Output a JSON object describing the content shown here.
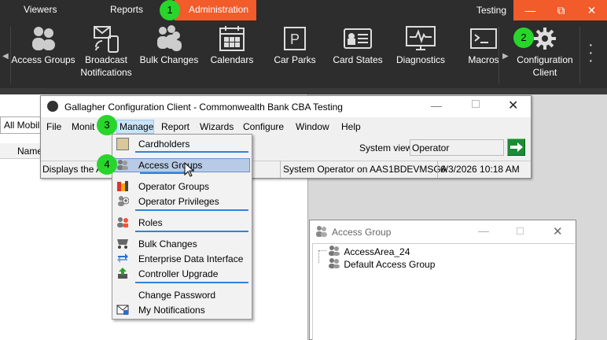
{
  "top_tabs": [
    "Viewers",
    "Reports",
    "Administration"
  ],
  "title_right": "Testing",
  "window_controls": {
    "minimize": "—",
    "maximize": "⧉",
    "close": "✕"
  },
  "ribbon": {
    "items": [
      {
        "label": "Access Groups",
        "icon": "people-icon"
      },
      {
        "label": "Broadcast Notifications",
        "icon": "broadcast-icon"
      },
      {
        "label": "Bulk Changes",
        "icon": "bulk-people-icon"
      },
      {
        "label": "Calendars",
        "icon": "calendar-icon"
      },
      {
        "label": "Car Parks",
        "icon": "parking-icon"
      },
      {
        "label": "Card States",
        "icon": "card-icon"
      },
      {
        "label": "Diagnostics",
        "icon": "monitor-pulse-icon"
      },
      {
        "label": "Macros",
        "icon": "terminal-icon"
      }
    ],
    "config_client": "Configuration Client"
  },
  "left_pane": {
    "filter": "All Mobil",
    "column": "Name"
  },
  "client": {
    "title": "Gallagher Configuration Client - Commonwealth Bank CBA Testing",
    "menu": [
      "File",
      "Monit",
      "Manage",
      "Report",
      "Wizards",
      "Configure",
      "Window",
      "Help"
    ],
    "system_view_label": "System view:",
    "system_view_value": "Operator",
    "status_left": "Displays the A",
    "status_operator": "System Operator on AAS1BDEVMSGA",
    "status_datetime": "6/3/2026 10:18 AM"
  },
  "dropdown": {
    "items": [
      {
        "label": "Cardholders",
        "icon": "cardholder-icon"
      },
      {
        "label": "Access Groups",
        "icon": "access-group-icon"
      },
      {
        "label": "Operator Groups",
        "icon": "operator-group-icon"
      },
      {
        "label": "Operator Privileges",
        "icon": "privileges-icon"
      },
      {
        "label": "Roles",
        "icon": "roles-icon"
      },
      {
        "label": "Bulk Changes",
        "icon": "bulk-change-icon"
      },
      {
        "label": "Enterprise Data Interface",
        "icon": "arrows-icon"
      },
      {
        "label": "Controller Upgrade",
        "icon": "upgrade-icon"
      },
      {
        "label": "Change Password",
        "icon": "none"
      },
      {
        "label": "My Notifications",
        "icon": "notification-icon"
      }
    ]
  },
  "access_group_window": {
    "title": "Access Group",
    "tree": [
      "AccessArea_24",
      "Default Access Group"
    ]
  },
  "badges": [
    "1",
    "2",
    "3",
    "4"
  ],
  "colors": {
    "accent": "#f25b2a",
    "ribbon_bg": "#2d2d2d",
    "badge": "#28d52b",
    "highlight": "#b8cbe6"
  }
}
